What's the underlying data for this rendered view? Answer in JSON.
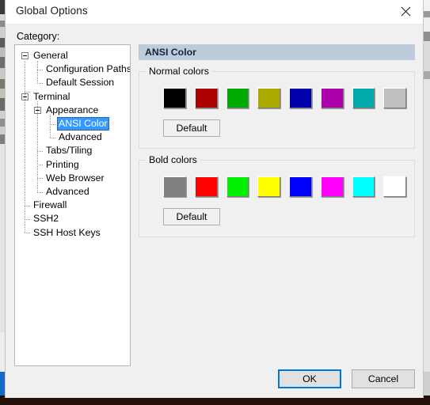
{
  "window": {
    "title": "Global Options",
    "close_icon": "close-icon"
  },
  "left": {
    "category_label": "Category:",
    "tree": [
      {
        "label": "General",
        "level": 0,
        "expander": "minus",
        "selected": false
      },
      {
        "label": "Configuration Paths",
        "level": 1,
        "expander": "none",
        "selected": false
      },
      {
        "label": "Default Session",
        "level": 1,
        "expander": "none",
        "selected": false
      },
      {
        "label": "Terminal",
        "level": 0,
        "expander": "minus",
        "selected": false
      },
      {
        "label": "Appearance",
        "level": 1,
        "expander": "minus",
        "selected": false
      },
      {
        "label": "ANSI Color",
        "level": 2,
        "expander": "none",
        "selected": true
      },
      {
        "label": "Advanced",
        "level": 2,
        "expander": "none",
        "selected": false
      },
      {
        "label": "Tabs/Tiling",
        "level": 1,
        "expander": "none",
        "selected": false
      },
      {
        "label": "Printing",
        "level": 1,
        "expander": "none",
        "selected": false
      },
      {
        "label": "Web Browser",
        "level": 1,
        "expander": "none",
        "selected": false
      },
      {
        "label": "Advanced",
        "level": 1,
        "expander": "none",
        "selected": false
      },
      {
        "label": "Firewall",
        "level": 0,
        "expander": "none",
        "selected": false
      },
      {
        "label": "SSH2",
        "level": 0,
        "expander": "none",
        "selected": false
      },
      {
        "label": "SSH Host Keys",
        "level": 0,
        "expander": "none",
        "selected": false
      }
    ],
    "selection_bg": "#3399ff",
    "selection_fg": "#ffffff"
  },
  "panel": {
    "header": "ANSI Color",
    "header_bg": "#bdcbdb",
    "normal": {
      "title": "Normal colors",
      "default_label": "Default",
      "colors": [
        "#000000",
        "#aa0000",
        "#00aa00",
        "#aaaa00",
        "#0000aa",
        "#aa00aa",
        "#00aaaa",
        "#c0c0c0"
      ]
    },
    "bold": {
      "title": "Bold colors",
      "default_label": "Default",
      "colors": [
        "#808080",
        "#ff0000",
        "#00ee00",
        "#ffff00",
        "#0000ff",
        "#ff00ff",
        "#00ffff",
        "#ffffff"
      ]
    }
  },
  "footer": {
    "ok_label": "OK",
    "cancel_label": "Cancel",
    "focus_color": "#0078d7"
  }
}
